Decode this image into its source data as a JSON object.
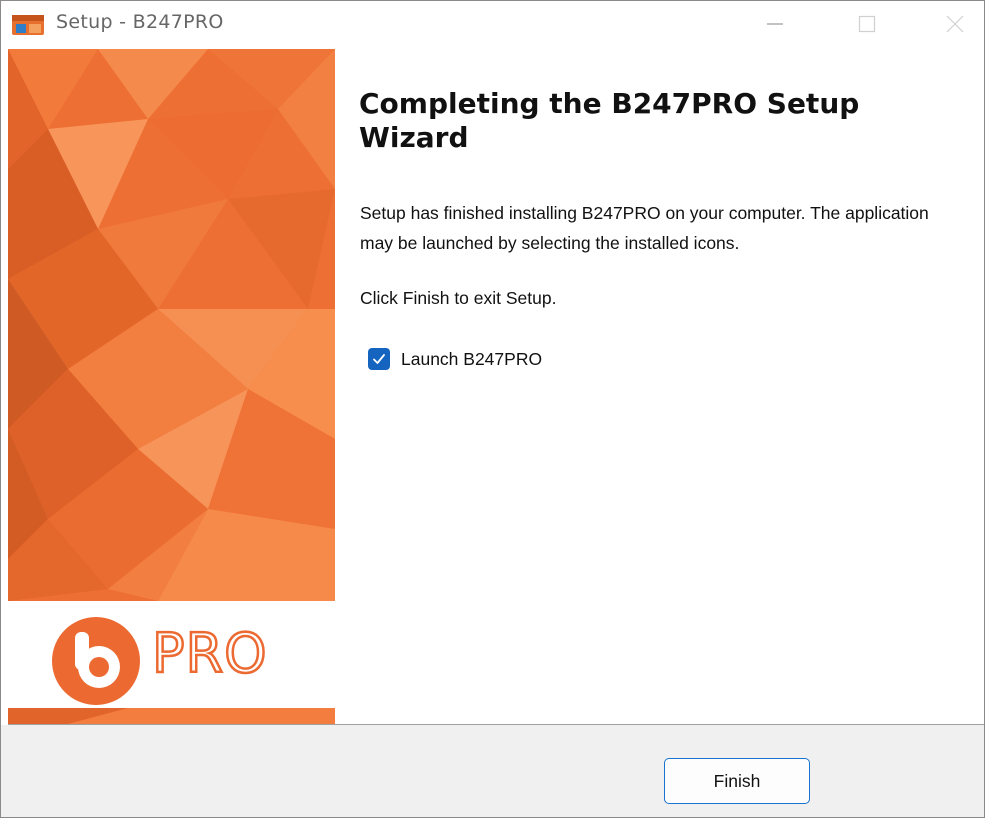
{
  "window": {
    "title": "Setup - B247PRO",
    "controls": {
      "minimize": "minimize",
      "maximize": "maximize",
      "close": "close"
    }
  },
  "sidebar": {
    "logo_text": "PRO",
    "colors": {
      "primary": "#ee6f33",
      "dark": "#d95e26",
      "light": "#f5874a"
    }
  },
  "content": {
    "heading": "Completing the B247PRO Setup Wizard",
    "paragraph1": "Setup has finished installing B247PRO on your computer. The application may be launched by selecting the installed icons.",
    "paragraph2": "Click Finish to exit Setup.",
    "launch_checkbox": {
      "label": "Launch B247PRO",
      "checked": true
    }
  },
  "footer": {
    "finish_label": "Finish"
  },
  "colors": {
    "accent": "#1565c0",
    "footer_bg": "#f0f0f0"
  }
}
